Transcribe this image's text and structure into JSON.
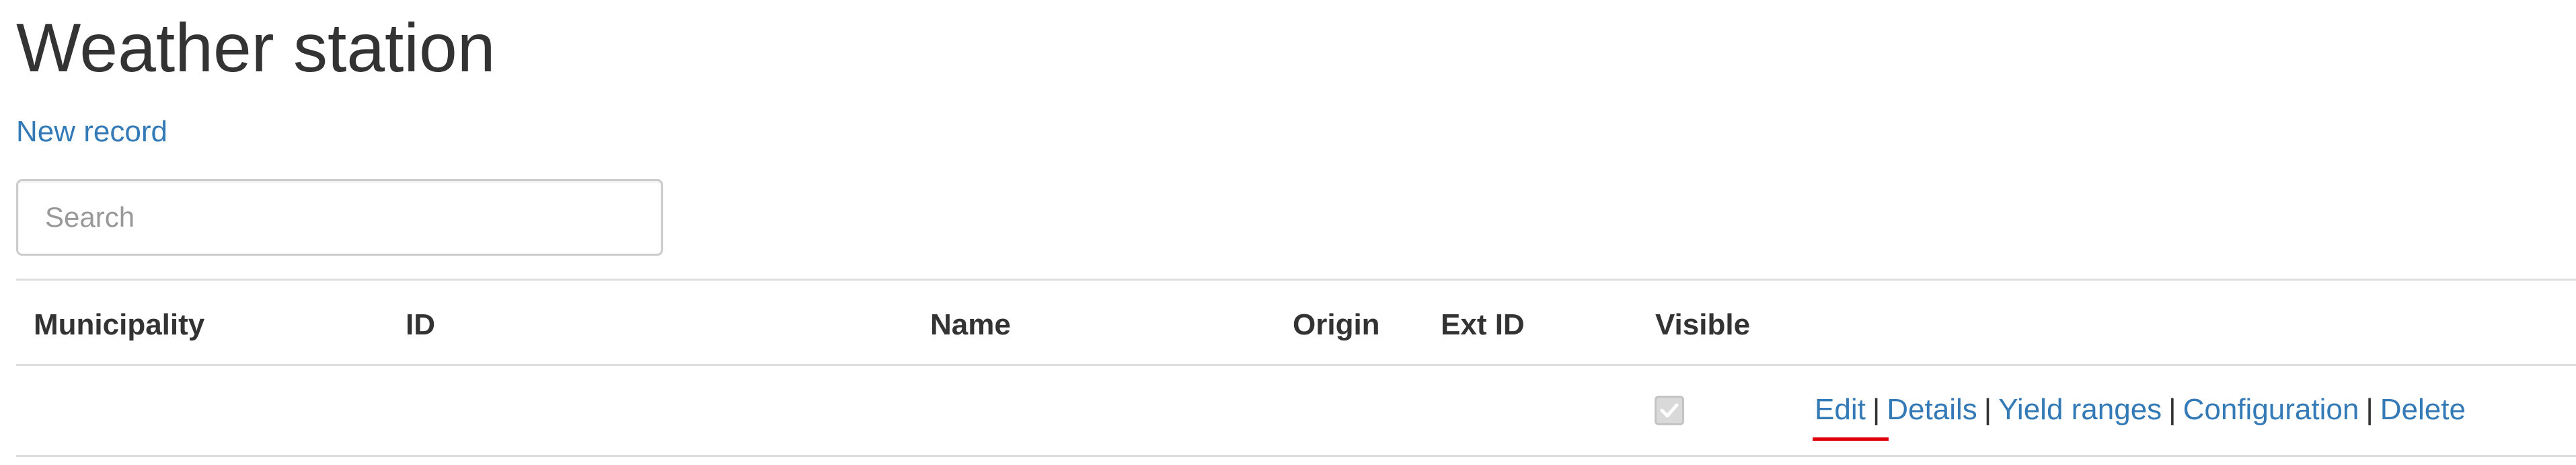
{
  "page": {
    "title": "Weather station",
    "new_record_label": "New record"
  },
  "search": {
    "placeholder": "Search",
    "value": ""
  },
  "table": {
    "columns": [
      "Municipality",
      "ID",
      "Name",
      "Origin",
      "Ext ID",
      "Visible"
    ],
    "rows": [
      {
        "municipality": "",
        "id": "",
        "name": "",
        "origin": "",
        "ext_id": "",
        "visible": true,
        "actions": [
          "Edit",
          "Details",
          "Yield ranges",
          "Configuration",
          "Delete"
        ],
        "separator": "|"
      }
    ]
  },
  "colors": {
    "link": "#337ab7",
    "text": "#333333",
    "border": "#dddddd",
    "focus_underline": "#e0000a"
  }
}
